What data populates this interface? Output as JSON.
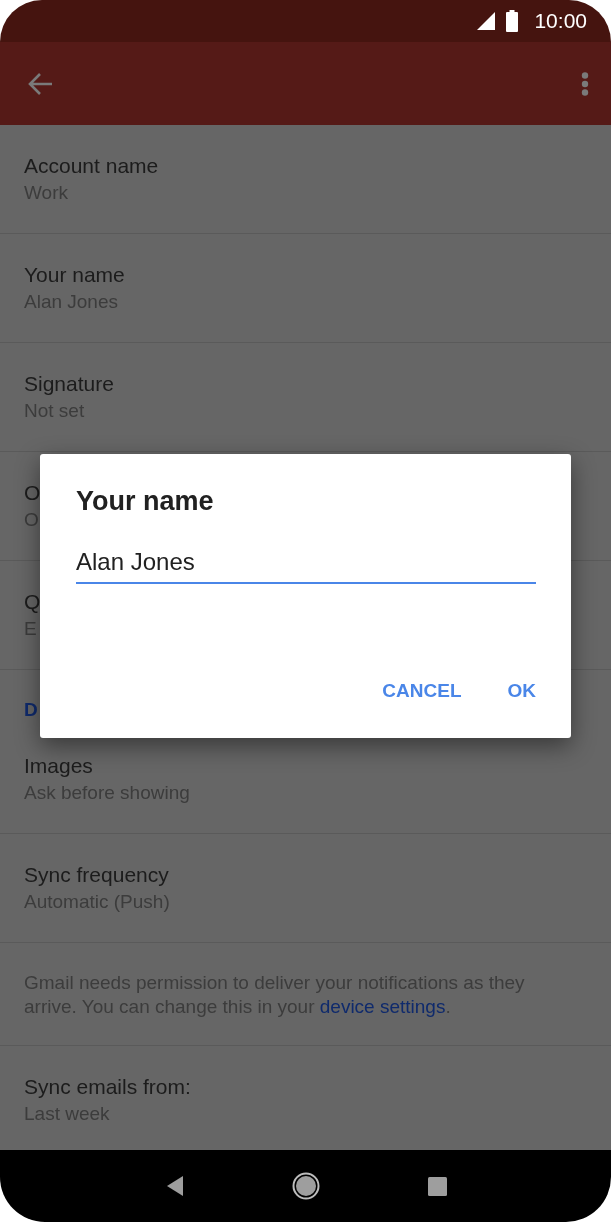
{
  "status_bar": {
    "time": "10:00"
  },
  "list": {
    "items": [
      {
        "kind": "setting",
        "title": "Account name",
        "subtitle": "Work"
      },
      {
        "kind": "setting",
        "title": "Your name",
        "subtitle": "Alan Jones"
      },
      {
        "kind": "setting",
        "title": "Signature",
        "subtitle": "Not set"
      },
      {
        "kind": "setting",
        "title": "O",
        "subtitle": "O"
      },
      {
        "kind": "setting",
        "title": "Q",
        "subtitle": "E"
      },
      {
        "kind": "section",
        "title": "D"
      },
      {
        "kind": "setting",
        "title": "Images",
        "subtitle": "Ask before showing"
      },
      {
        "kind": "setting",
        "title": "Sync frequency",
        "subtitle": "Automatic (Push)"
      },
      {
        "kind": "notice",
        "text": "Gmail needs permission to deliver your notifications as they arrive. You can change this in your ",
        "link": "device settings",
        "text_after": "."
      },
      {
        "kind": "setting",
        "title": "Sync emails from:",
        "subtitle": "Last week"
      }
    ]
  },
  "dialog": {
    "title": "Your name",
    "value": "Alan Jones",
    "buttons": [
      "CANCEL",
      "OK"
    ]
  }
}
